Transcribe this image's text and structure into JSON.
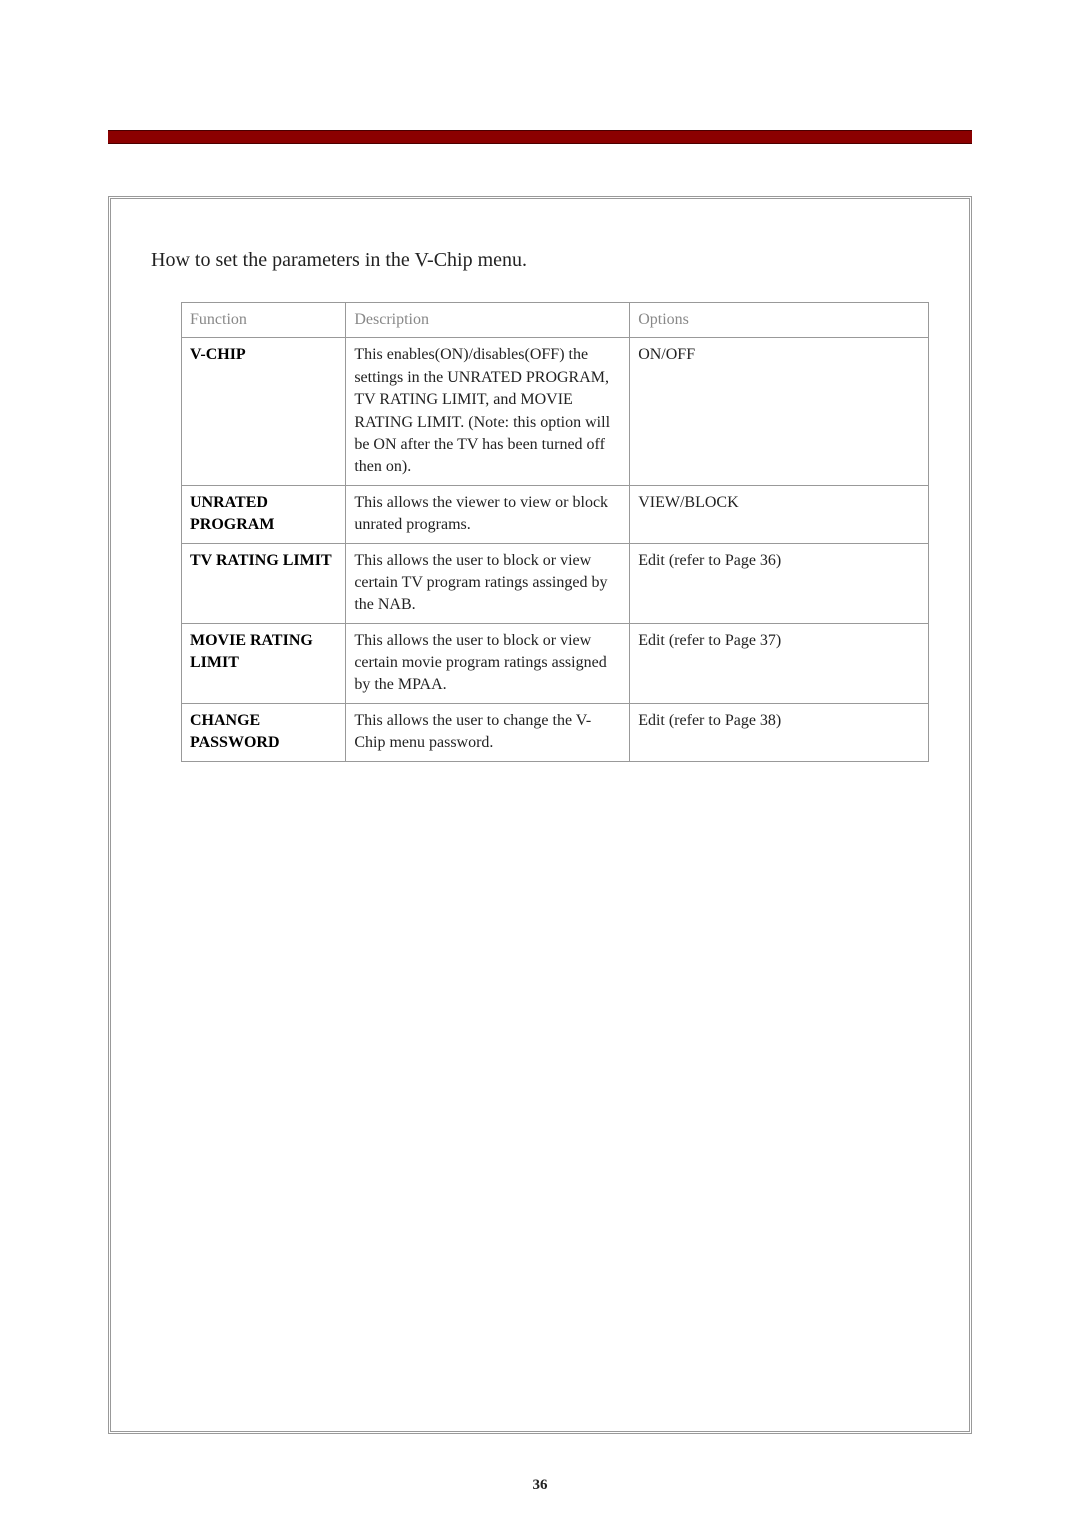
{
  "page": {
    "title": "How to set the parameters in the V-Chip menu.",
    "number": "36"
  },
  "table": {
    "headers": {
      "function": "Function",
      "description": "Description",
      "options": "Options"
    },
    "rows": [
      {
        "function": "V-CHIP",
        "description": "This enables(ON)/disables(OFF) the settings in the UNRATED PROGRAM, TV RATING LIMIT, and MOVIE RATING LIMIT. (Note: this option will be ON after the TV has been turned off then on).",
        "options": "ON/OFF"
      },
      {
        "function": "UNRATED PROGRAM",
        "description": "This allows the viewer to view or block unrated programs.",
        "options": "VIEW/BLOCK"
      },
      {
        "function": "TV RATING LIMIT",
        "description": "This allows the user to block or view certain TV program ratings assinged by the NAB.",
        "options": "Edit (refer to Page 36)"
      },
      {
        "function": "MOVIE RATING LIMIT",
        "description": "This allows the user to block or view certain movie program ratings assigned by the MPAA.",
        "options": "Edit (refer to Page 37)"
      },
      {
        "function": "CHANGE PASSWORD",
        "description": "This allows the user to change the V-Chip menu password.",
        "options": "Edit (refer to Page 38)"
      }
    ]
  }
}
